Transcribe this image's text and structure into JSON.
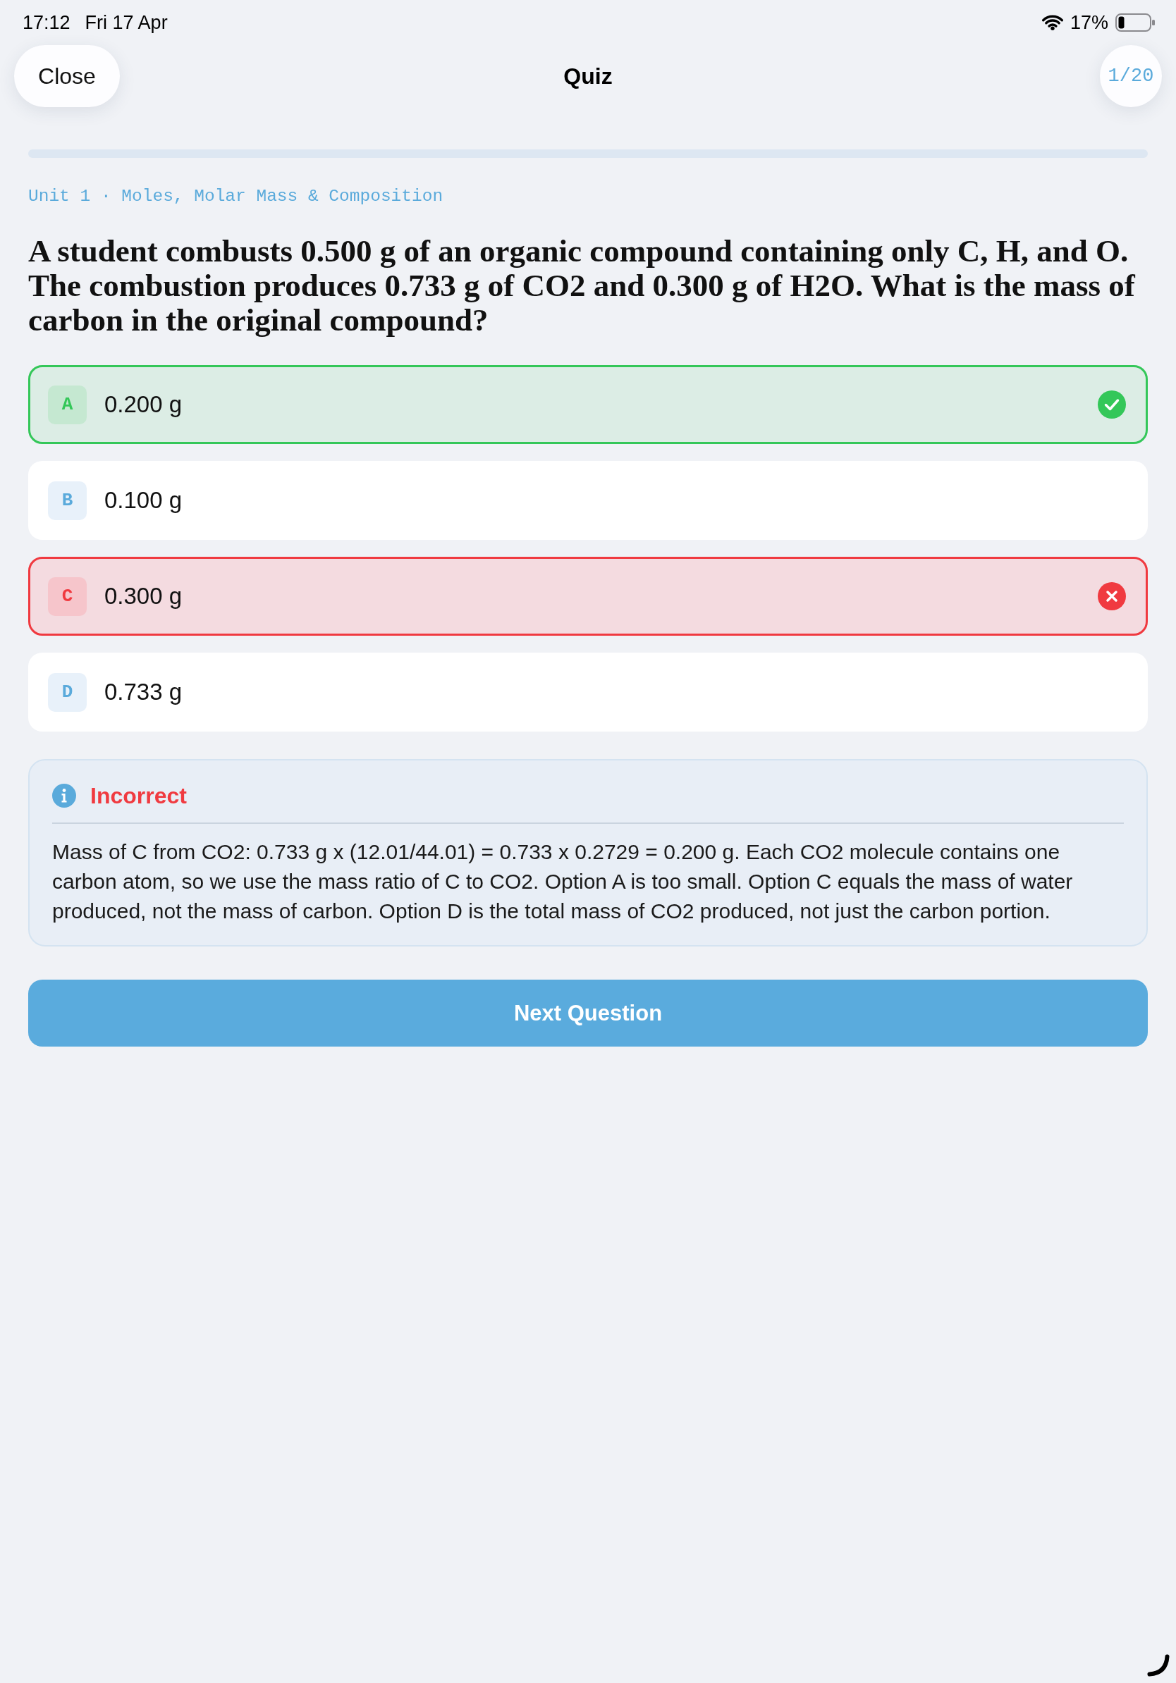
{
  "status_bar": {
    "time": "17:12",
    "date": "Fri 17 Apr",
    "battery": "17%"
  },
  "header": {
    "close_button": "Close",
    "title": "Quiz",
    "counter": "1/20"
  },
  "progress": {
    "level": 0
  },
  "breadcrumb": "Unit 1 · Moles, Molar Mass & Composition",
  "question": "A student combusts 0.500 g of an organic compound containing only C, H, and O. The combustion produces 0.733 g of CO2 and 0.300 g of H2O. What is the mass of carbon in the original compound?",
  "options": [
    {
      "letter": "A",
      "text": "0.200 g",
      "kind": "correct"
    },
    {
      "letter": "B",
      "text": "0.100 g",
      "kind": "plain"
    },
    {
      "letter": "C",
      "text": "0.300 g",
      "kind": "incorrect"
    },
    {
      "letter": "D",
      "text": "0.733 g",
      "kind": "plain"
    }
  ],
  "feedback": {
    "correct": false,
    "title": "Incorrect",
    "text": "Mass of C from CO2: 0.733 g x (12.01/44.01) = 0.733 x 0.2729 = 0.200 g. Each CO2 molecule contains one carbon atom, so we use the mass ratio of C to CO2. Option A is too small. Option C equals the mass of water produced, not the mass of carbon. Option D is the total mass of CO2 produced, not just the carbon portion."
  },
  "next_button": "Next Question"
}
